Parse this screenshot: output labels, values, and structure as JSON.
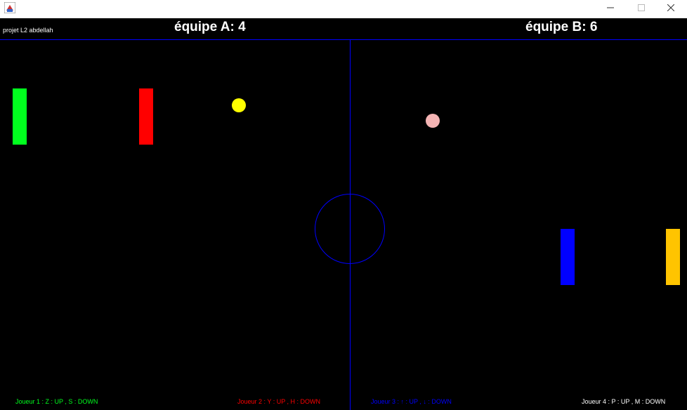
{
  "window": {
    "icon": "java-app-icon",
    "controls": [
      "minimize-icon",
      "maximize-icon",
      "close-icon"
    ]
  },
  "game": {
    "project_label": "projet L2 abdellah",
    "score_a_label": "équipe A: 4",
    "score_b_label": "équipe B: 6",
    "score_a": 4,
    "score_b": 6,
    "line_color": "#0000ff",
    "paddles": [
      {
        "name": "player-1",
        "color": "#00ff1e"
      },
      {
        "name": "player-2",
        "color": "#ff0000"
      },
      {
        "name": "player-3",
        "color": "#0000ff"
      },
      {
        "name": "player-4",
        "color": "#ffc400"
      }
    ],
    "balls": [
      {
        "name": "ball-yellow",
        "color": "#ffff00"
      },
      {
        "name": "ball-pink",
        "color": "#f4b4b4"
      }
    ],
    "controls": [
      {
        "text": "Joueur 1 : Z : UP , S : DOWN",
        "color": "#00ff1e"
      },
      {
        "text": "Joueur 2 : Y : UP , H : DOWN",
        "color": "#ff0000"
      },
      {
        "text": "Joueur 3 : ↑ : UP , ↓ : DOWN",
        "color": "#0000ff"
      },
      {
        "text": "Joueur 4 : P : UP , M : DOWN",
        "color": "#ffffff"
      }
    ]
  }
}
